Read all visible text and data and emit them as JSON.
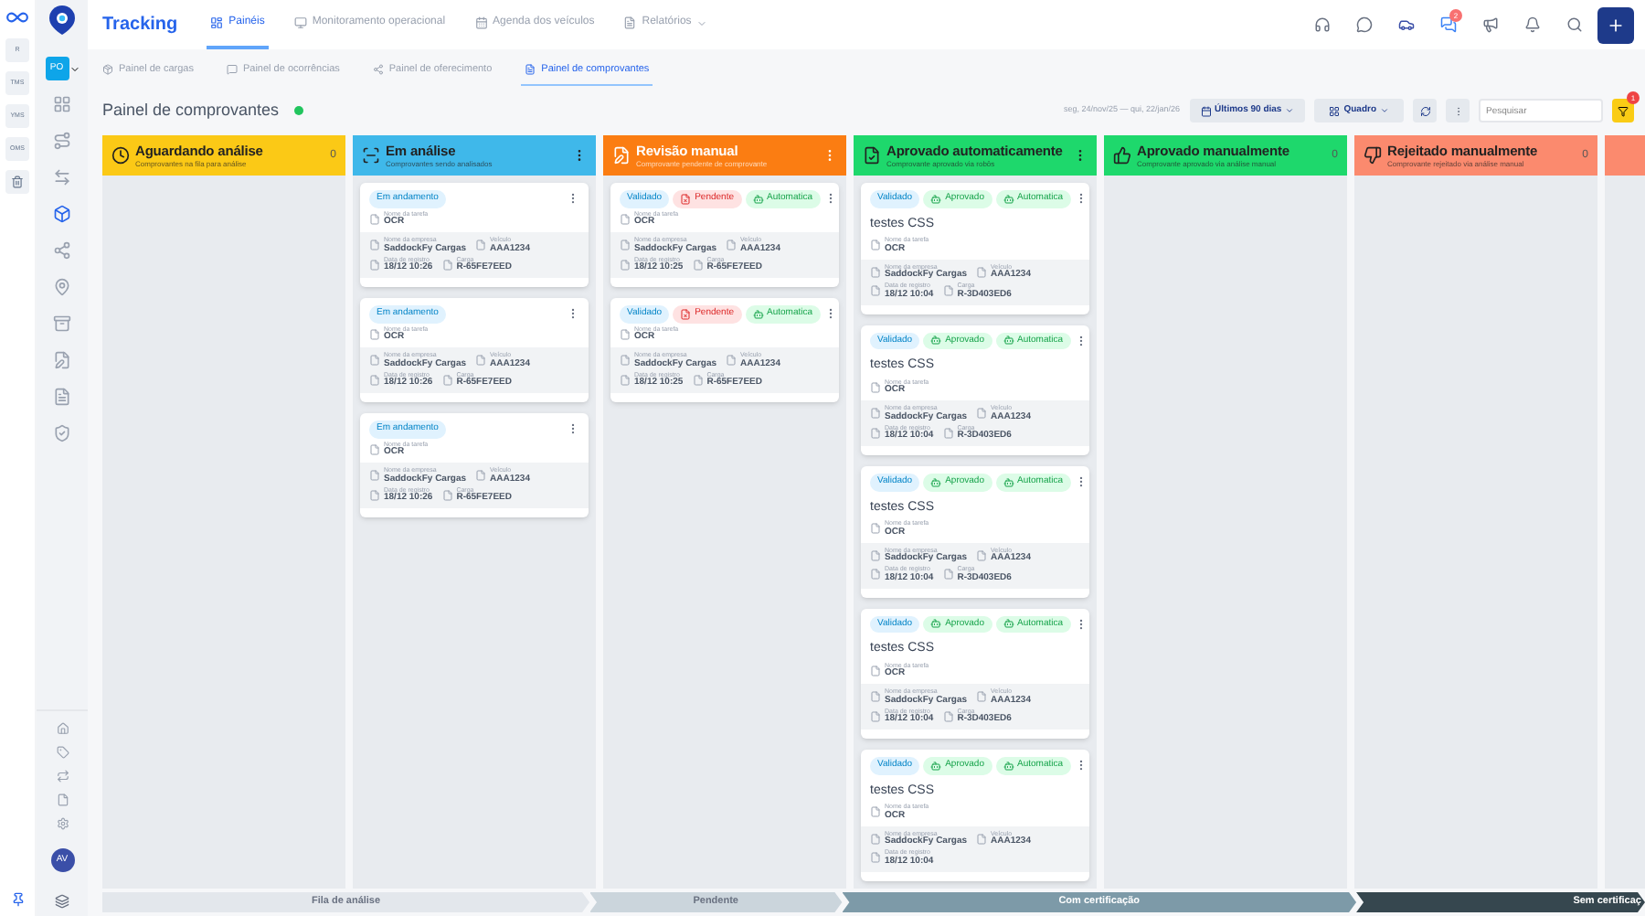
{
  "rail": {
    "items": [
      {
        "label": "R",
        "selected": false
      },
      {
        "label": "TMS",
        "selected": false
      },
      {
        "label": "YMS",
        "selected": false
      },
      {
        "label": "OMS",
        "selected": false
      }
    ]
  },
  "org": {
    "label": "PO"
  },
  "nav": {
    "title": "Tracking",
    "tabs": [
      {
        "label": "Painéis",
        "selected": true
      },
      {
        "label": "Monitoramento operacional",
        "selected": false
      },
      {
        "label": "Agenda dos veículos",
        "selected": false
      },
      {
        "label": "Relatórios",
        "selected": false,
        "dropdown": true
      }
    ],
    "chat_badge": "2"
  },
  "subtabs": [
    {
      "label": "Painel de cargas",
      "selected": false
    },
    {
      "label": "Painel de ocorrências",
      "selected": false
    },
    {
      "label": "Painel de oferecimento",
      "selected": false
    },
    {
      "label": "Painel de comprovantes",
      "selected": true
    }
  ],
  "sidebar": {
    "items": [
      {
        "selected": false
      },
      {
        "selected": false
      },
      {
        "selected": false
      },
      {
        "selected": true
      },
      {
        "selected": false
      },
      {
        "selected": false
      },
      {
        "selected": false
      },
      {
        "selected": false
      },
      {
        "selected": false
      },
      {
        "selected": false
      }
    ],
    "avatar": "AV"
  },
  "header": {
    "title": "Painel de comprovantes",
    "online": true,
    "range": "seg, 24/nov/25 — qui, 22/jan/26",
    "period": "Últimos 90 dias",
    "view": "Quadro",
    "search_placeholder": "Pesquisar",
    "filter_badge": "1"
  },
  "columns": [
    {
      "title": "Aguardando análise",
      "subtitle": "Comprovantes na fila para análise",
      "color": "#fbc916",
      "dark": true,
      "count": "0"
    },
    {
      "title": "Em análise",
      "subtitle": "Comprovantes sendo analisados",
      "color": "#3fb8ea",
      "dark": true,
      "cards": [
        {
          "badges": [
            {
              "label": "Em andamento",
              "kind": "info"
            }
          ],
          "task_label": "Nome da tarefa",
          "task": "OCR",
          "fields": [
            {
              "label": "Nome da empresa",
              "value": "SaddockFy Cargas"
            },
            {
              "label": "Veículo",
              "value": "AAA1234"
            },
            {
              "label": "Data de registro",
              "value": "18/12 10:26"
            },
            {
              "label": "Carga",
              "value": "R-65FE7EED"
            }
          ]
        },
        {
          "badges": [
            {
              "label": "Em andamento",
              "kind": "info"
            }
          ],
          "task_label": "Nome da tarefa",
          "task": "OCR",
          "fields": [
            {
              "label": "Nome da empresa",
              "value": "SaddockFy Cargas"
            },
            {
              "label": "Veículo",
              "value": "AAA1234"
            },
            {
              "label": "Data de registro",
              "value": "18/12 10:26"
            },
            {
              "label": "Carga",
              "value": "R-65FE7EED"
            }
          ]
        },
        {
          "badges": [
            {
              "label": "Em andamento",
              "kind": "info"
            }
          ],
          "task_label": "Nome da tarefa",
          "task": "OCR",
          "fields": [
            {
              "label": "Nome da empresa",
              "value": "SaddockFy Cargas"
            },
            {
              "label": "Veículo",
              "value": "AAA1234"
            },
            {
              "label": "Data de registro",
              "value": "18/12 10:26"
            },
            {
              "label": "Carga",
              "value": "R-65FE7EED"
            }
          ]
        }
      ]
    },
    {
      "title": "Revisão manual",
      "subtitle": "Comprovante pendente de comprovante",
      "color": "#fb7d12",
      "dark": false,
      "cards": [
        {
          "badges": [
            {
              "label": "Validado",
              "kind": "info"
            },
            {
              "label": "Pendente",
              "kind": "danger"
            },
            {
              "label": "Automatica",
              "kind": "success"
            }
          ],
          "task_label": "Nome da tarefa",
          "task": "OCR",
          "fields": [
            {
              "label": "Nome da empresa",
              "value": "SaddockFy Cargas"
            },
            {
              "label": "Veículo",
              "value": "AAA1234"
            },
            {
              "label": "Data de registro",
              "value": "18/12 10:25"
            },
            {
              "label": "Carga",
              "value": "R-65FE7EED"
            }
          ]
        },
        {
          "badges": [
            {
              "label": "Validado",
              "kind": "info"
            },
            {
              "label": "Pendente",
              "kind": "danger"
            },
            {
              "label": "Automatica",
              "kind": "success"
            }
          ],
          "task_label": "Nome da tarefa",
          "task": "OCR",
          "fields": [
            {
              "label": "Nome da empresa",
              "value": "SaddockFy Cargas"
            },
            {
              "label": "Veículo",
              "value": "AAA1234"
            },
            {
              "label": "Data de registro",
              "value": "18/12 10:25"
            },
            {
              "label": "Carga",
              "value": "R-65FE7EED"
            }
          ]
        }
      ]
    },
    {
      "title": "Aprovado automaticamente",
      "subtitle": "Comprovante aprovado via robôs",
      "color": "#1ed86c",
      "dark": true,
      "cards": [
        {
          "badges": [
            {
              "label": "Validado",
              "kind": "info"
            },
            {
              "label": "Aprovado",
              "kind": "success"
            },
            {
              "label": "Automatica",
              "kind": "success"
            }
          ],
          "title": "testes CSS",
          "task_label": "Nome da tarefa",
          "task": "OCR",
          "fields": [
            {
              "label": "Nome da empresa",
              "value": "SaddockFy Cargas"
            },
            {
              "label": "Veículo",
              "value": "AAA1234"
            },
            {
              "label": "Data de registro",
              "value": "18/12 10:04"
            },
            {
              "label": "Carga",
              "value": "R-3D403ED6"
            }
          ]
        },
        {
          "badges": [
            {
              "label": "Validado",
              "kind": "info"
            },
            {
              "label": "Aprovado",
              "kind": "success"
            },
            {
              "label": "Automatica",
              "kind": "success"
            }
          ],
          "title": "testes CSS",
          "task_label": "Nome da tarefa",
          "task": "OCR",
          "fields": [
            {
              "label": "Nome da empresa",
              "value": "SaddockFy Cargas"
            },
            {
              "label": "Veículo",
              "value": "AAA1234"
            },
            {
              "label": "Data de registro",
              "value": "18/12 10:04"
            },
            {
              "label": "Carga",
              "value": "R-3D403ED6"
            }
          ]
        },
        {
          "badges": [
            {
              "label": "Validado",
              "kind": "info"
            },
            {
              "label": "Aprovado",
              "kind": "success"
            },
            {
              "label": "Automatica",
              "kind": "success"
            }
          ],
          "title": "testes CSS",
          "task_label": "Nome da tarefa",
          "task": "OCR",
          "fields": [
            {
              "label": "Nome da empresa",
              "value": "SaddockFy Cargas"
            },
            {
              "label": "Veículo",
              "value": "AAA1234"
            },
            {
              "label": "Data de registro",
              "value": "18/12 10:04"
            },
            {
              "label": "Carga",
              "value": "R-3D403ED6"
            }
          ]
        },
        {
          "badges": [
            {
              "label": "Validado",
              "kind": "info"
            },
            {
              "label": "Aprovado",
              "kind": "success"
            },
            {
              "label": "Automatica",
              "kind": "success"
            }
          ],
          "title": "testes CSS",
          "task_label": "Nome da tarefa",
          "task": "OCR",
          "fields": [
            {
              "label": "Nome da empresa",
              "value": "SaddockFy Cargas"
            },
            {
              "label": "Veículo",
              "value": "AAA1234"
            },
            {
              "label": "Data de registro",
              "value": "18/12 10:04"
            },
            {
              "label": "Carga",
              "value": "R-3D403ED6"
            }
          ]
        },
        {
          "badges": [
            {
              "label": "Validado",
              "kind": "info"
            },
            {
              "label": "Aprovado",
              "kind": "success"
            },
            {
              "label": "Automatica",
              "kind": "success"
            }
          ],
          "title": "testes CSS",
          "task_label": "Nome da tarefa",
          "task": "OCR",
          "fields": [
            {
              "label": "Nome da empresa",
              "value": "SaddockFy Cargas"
            },
            {
              "label": "Veículo",
              "value": "AAA1234"
            },
            {
              "label": "Data de registro",
              "value": "18/12 10:04"
            }
          ]
        }
      ]
    },
    {
      "title": "Aprovado manualmente",
      "subtitle": "Comprovante aprovado via análise manual",
      "color": "#1ed86c",
      "dark": true,
      "count": "0"
    },
    {
      "title": "Rejeitado manualmente",
      "subtitle": "Comprovante rejeitado via análise manual",
      "color": "#fb8a6e",
      "dark": true,
      "count": "0"
    },
    {
      "color": "#fb8a6e"
    }
  ],
  "stages": [
    {
      "label": "Fila de análise",
      "color": "#e3e7ec",
      "dark": true
    },
    {
      "label": "Pendente",
      "color": "#cbd5dc",
      "dark": true
    },
    {
      "label": "Com certificação",
      "color": "#7d9aa8",
      "dark": false
    },
    {
      "label": "Sem certificaç",
      "color": "#36474f",
      "dark": false
    }
  ]
}
